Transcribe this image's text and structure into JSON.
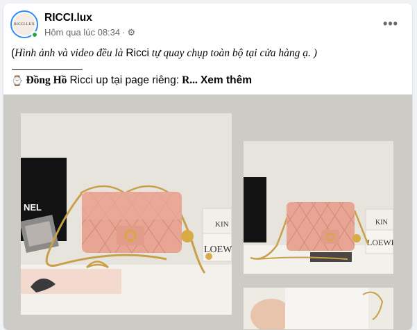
{
  "post": {
    "page_name": "RICCI.lux",
    "avatar_text": "RICCI.LUX",
    "timestamp": "Hôm qua lúc 08:34",
    "more_label": "•••",
    "caption_open": "(",
    "caption_italic_1": "Hình ảnh và video đều là ",
    "caption_plain": "Ricci",
    "caption_italic_2": " tự quay chụp toàn bộ tại cửa hàng ạ. )",
    "line2_icon": "⌚",
    "line2_bold": "Đồng Hồ",
    "line2_text": "Ricci up tại page riêng:",
    "line2_trunc": "R...",
    "see_more": "Xem thêm"
  },
  "photos": {
    "main_box_text": "NEL",
    "main_box2_text": "LOEWE",
    "main_box2_top": "KIN",
    "side_box_text": "LOEWE",
    "side_box_top": "KIN"
  },
  "colors": {
    "bag_pink": "#e8a593",
    "chain_gold": "#c9a04a",
    "background": "#cdcbc6",
    "online": "#31a24c",
    "avatar_ring": "#2e89ff"
  }
}
